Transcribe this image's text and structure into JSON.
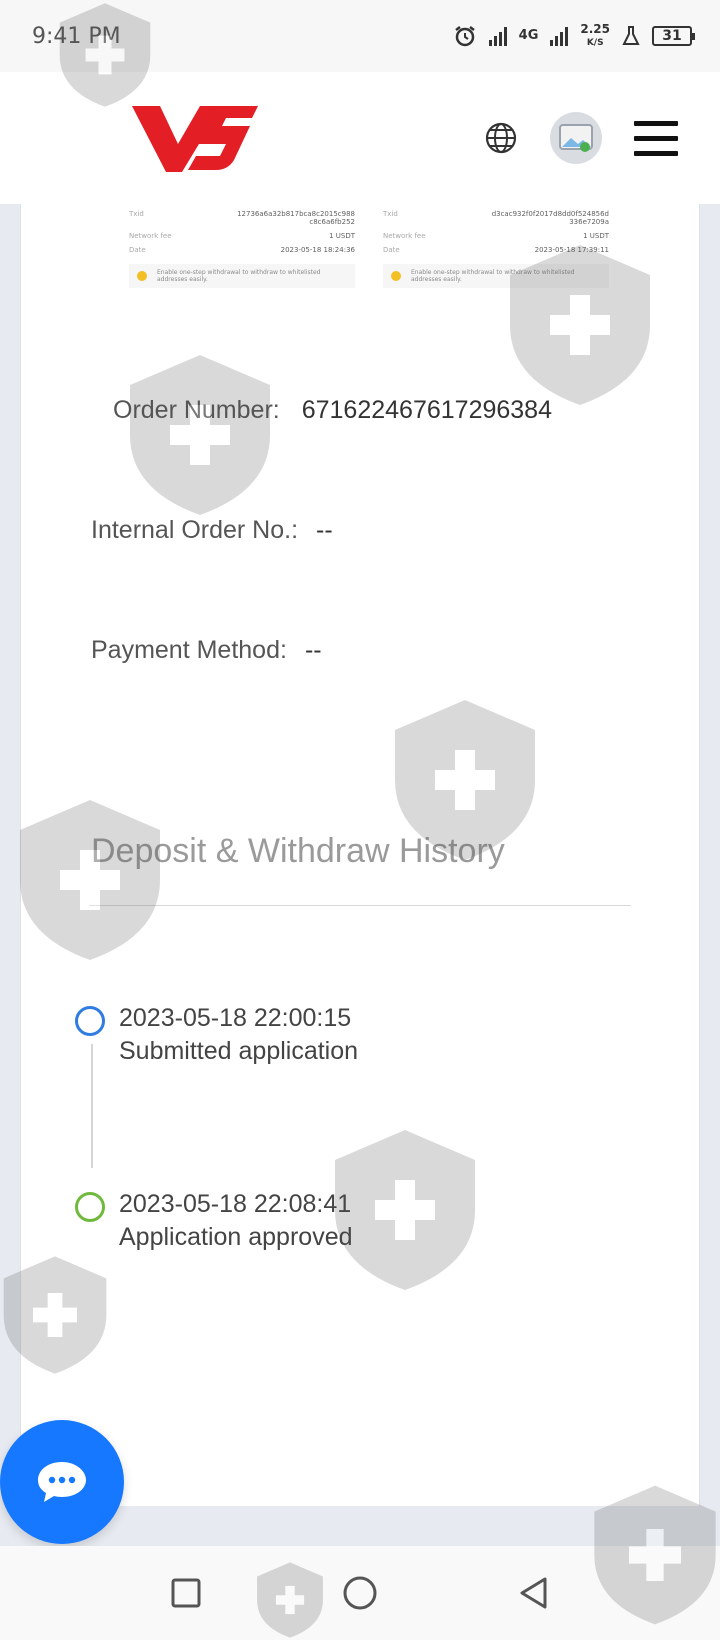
{
  "status_bar": {
    "time": "9:41 PM",
    "network": "4G",
    "speed_value": "2.25",
    "speed_unit": "K/S",
    "battery": "31"
  },
  "receipt": {
    "left": {
      "txid_label": "Txid",
      "txid_value": "12736a6a32b817bca8c2015c988 c8c6a6fb252",
      "fee_label": "Network fee",
      "fee_value": "1 USDT",
      "date_label": "Date",
      "date_value": "2023-05-18 18:24:36",
      "note": "Enable one-step withdrawal to withdraw to whitelisted addresses easily."
    },
    "right": {
      "txid_label": "Txid",
      "txid_value": "d3cac932f0f2017d8dd0f524856d 336e7209a",
      "fee_label": "Network fee",
      "fee_value": "1 USDT",
      "date_label": "Date",
      "date_value": "2023-05-18 17:39:11",
      "note": "Enable one-step withdrawal to withdraw to whitelisted addresses easily."
    }
  },
  "order": {
    "number_label": "Order Number:",
    "number_value": "671622467617296384",
    "internal_label": "Internal Order No.:",
    "internal_value": "--",
    "payment_label": "Payment Method:",
    "payment_value": "--"
  },
  "history": {
    "title": "Deposit & Withdraw History",
    "events": [
      {
        "time": "2023-05-18 22:00:15",
        "status": "Submitted application",
        "color": "#2f7de1"
      },
      {
        "time": "2023-05-18 22:08:41",
        "status": "Application approved",
        "color": "#6fba3c"
      }
    ]
  },
  "colors": {
    "brand_red": "#e31e24",
    "chat_blue": "#1677ff"
  }
}
